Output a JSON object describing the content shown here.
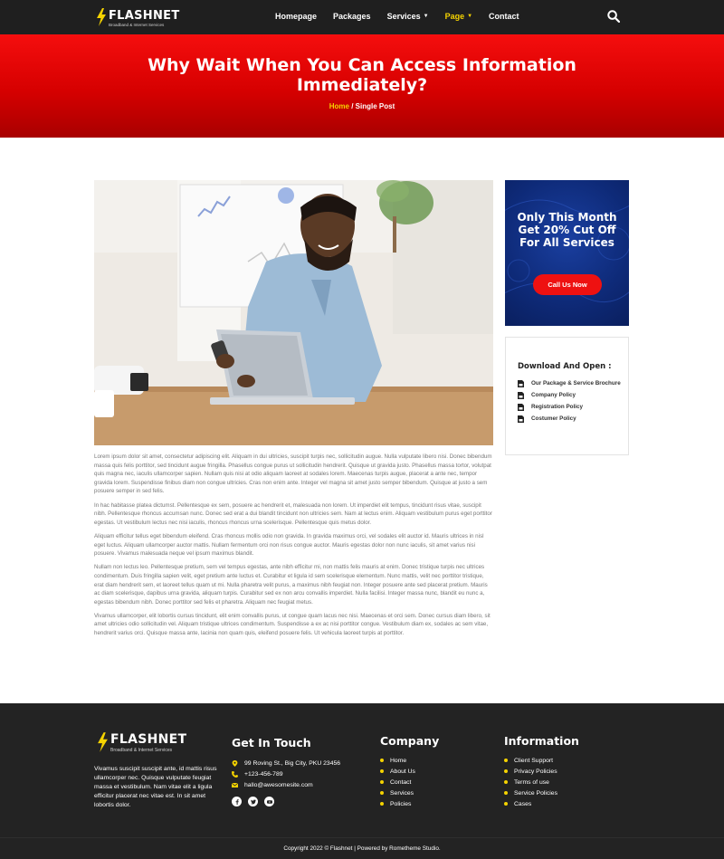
{
  "brand": {
    "name": "FLASHNET",
    "tagline": "Broadband & Internet Services",
    "accent": "#f5d300",
    "hero_red": "#e80a0a",
    "promo_blue": "#0e2a78"
  },
  "nav": {
    "items": [
      {
        "label": "Homepage"
      },
      {
        "label": "Packages"
      },
      {
        "label": "Services"
      },
      {
        "label": "Page"
      },
      {
        "label": "Contact"
      }
    ],
    "search_icon": "search-icon"
  },
  "hero": {
    "title": "Why Wait When You Can Access Information Immediately?",
    "breadcrumb_home": "Home",
    "breadcrumb_sep": " / ",
    "breadcrumb_current": "Single Post"
  },
  "article": {
    "paragraphs": [
      "Lorem ipsum dolor sit amet, consectetur adipiscing elit. Aliquam in dui ultricies, suscipit turpis nec, sollicitudin augue. Nulla vulputate libero nisi. Donec bibendum massa quis felis porttitor, sed tincidunt augue fringilla. Phasellus congue purus ut sollicitudin hendrerit. Quisque ut gravida justo. Phasellus massa tortor, volutpat quis magna nec, iaculis ullamcorper sapien. Nullam quis nisi at odio aliquam laoreet at sodales lorem. Maecenas turpis augue, placerat a ante nec, tempor gravida lorem. Suspendisse finibus diam non congue ultricies. Cras non enim ante. Integer vel magna sit amet justo semper bibendum. Quisque at justo a sem posuere semper in sed felis.",
      "In hac habitasse platea dictumst. Pellentesque ex sem, posuere ac hendrerit et, malesuada non lorem. Ut imperdiet elit tempus, tincidunt risus vitae, suscipit nibh. Pellentesque rhoncus accumsan nunc. Donec sed erat a dui blandit tincidunt non ultricies sem. Nam at lectus enim. Aliquam vestibulum purus eget porttitor egestas. Ut vestibulum lectus nec nisi iaculis, rhoncus rhoncus urna scelerisque. Pellentesque quis metus dolor.",
      "Aliquam efficitur tellus eget bibendum eleifend. Cras rhoncus mollis odio non gravida. In gravida maximus orci, vel sodales elit auctor id. Mauris ultrices in nisl eget luctus. Aliquam ullamcorper auctor mattis. Nullam fermentum orci non risus congue auctor. Mauris egestas dolor non nunc iaculis, sit amet varius nisi posuere. Vivamus malesuada neque vel ipsum maximus blandit.",
      "Nullam non lectus leo. Pellentesque pretium, sem vel tempus egestas, ante nibh efficitur mi, non mattis felis mauris at enim. Donec tristique turpis nec ultrices condimentum. Duis fringilla sapien velit, eget pretium ante luctus et. Curabitur et ligula id sem scelerisque elementum. Nunc mattis, velit nec porttitor tristique, erat diam hendrerit sem, et laoreet tellus quam ut mi. Nulla pharetra velit purus, a maximus nibh feugiat non. Integer posuere ante sed placerat pretium. Mauris ac diam scelerisque, dapibus urna gravida, aliquam turpis. Curabitur sed ex non arcu convallis imperdiet. Nulla facilisi. Integer massa nunc, blandit eu nunc a, egestas bibendum nibh. Donec porttitor sed felis et pharetra. Aliquam nec feugiat metus.",
      "Vivamus ullamcorper, elit lobortis cursus tincidunt, elit enim convallis purus, ut congue quam lacus nec nisi. Maecenas et orci sem. Donec cursus diam libero, sit amet ultricies odio sollicitudin vel. Aliquam tristique ultrices condimentum. Suspendisse a ex ac nisi porttitor congue. Vestibulum diam ex, sodales ac sem vitae, hendrerit varius orci. Quisque massa ante, lacinia non quam quis, eleifend posuere felis. Ut vehicula laoreet turpis at porttitor."
    ]
  },
  "promo": {
    "title": "Only This Month Get 20% Cut Off For All Services",
    "button": "Call Us Now"
  },
  "download": {
    "title": "Download And Open :",
    "items": [
      {
        "label": "Our Package & Service Brochure",
        "icon": "pdf-file-icon"
      },
      {
        "label": "Company Policy",
        "icon": "pdf-file-icon"
      },
      {
        "label": "Registration Policy",
        "icon": "pdf-file-icon"
      },
      {
        "label": "Costumer Policy",
        "icon": "pdf-file-icon"
      }
    ]
  },
  "footer": {
    "about": "Vivamus suscipit suscipit ante, id mattis risus ullamcorper nec. Quisque vulputate feugiat massa et vestibulum. Nam vitae elit a ligula efficitur placerat nec vitae est. In sit amet lobortis dolor.",
    "contact": {
      "title": "Get In Touch",
      "address": "99 Roving St., Big City, PKU 23456",
      "phone": "+123-456-789",
      "email": "hallo@awesomesite.com",
      "socials": [
        "facebook-icon",
        "twitter-icon",
        "youtube-icon"
      ]
    },
    "company": {
      "title": "Company",
      "links": [
        "Home",
        "About Us",
        "Contact",
        "Services",
        "Policies"
      ]
    },
    "information": {
      "title": "Information",
      "links": [
        "Client Support",
        "Privacy Policies",
        "Terms of use",
        "Service Policies",
        "Cases"
      ]
    },
    "copyright": "Copyright 2022 © Flashnet | Powered by Rometheme Studio."
  }
}
